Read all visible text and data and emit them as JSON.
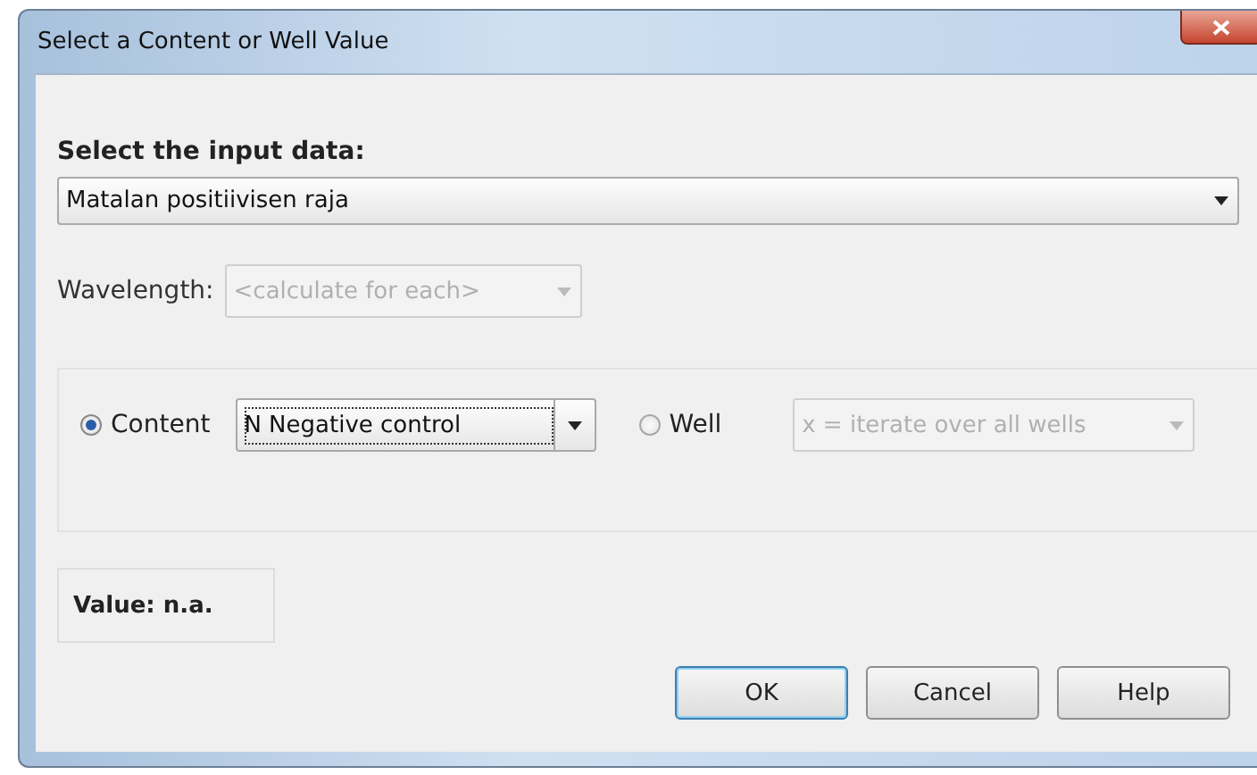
{
  "window": {
    "title": "Select a Content or Well Value"
  },
  "input_data": {
    "heading": "Select the input data:",
    "dropdown": {
      "value": "Matalan positiivisen raja",
      "disabled": false
    }
  },
  "wavelength": {
    "label": "Wavelength:",
    "dropdown": {
      "value": "<calculate for each>",
      "disabled": true
    }
  },
  "source_options": [
    {
      "label": "Content",
      "selected": true,
      "dropdown": {
        "value": "N Negative control",
        "disabled": false,
        "focused": true
      }
    },
    {
      "label": "Well",
      "selected": false,
      "dropdown": {
        "value": "x = iterate over all wells",
        "disabled": true,
        "focused": false
      }
    }
  ],
  "value_label": "Value: n.a.",
  "buttons": [
    {
      "label": "OK",
      "default": true
    },
    {
      "label": "Cancel",
      "default": false
    },
    {
      "label": "Help",
      "default": false
    }
  ]
}
